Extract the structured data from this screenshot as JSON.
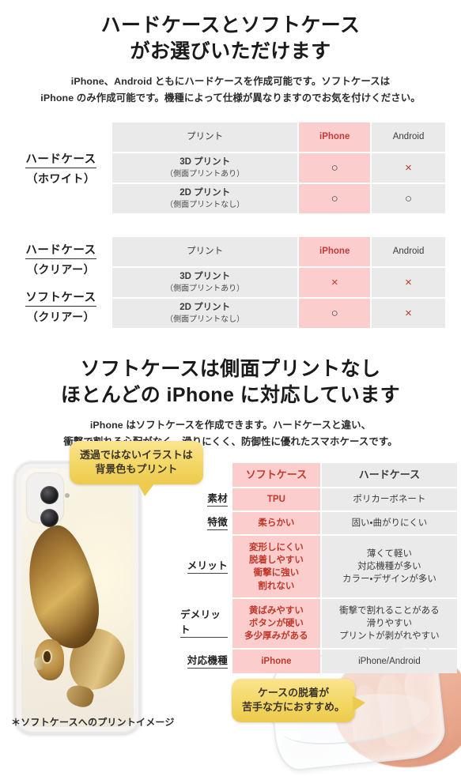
{
  "colors": {
    "pink_cell": "#fbcdcd",
    "gray_cell": "#eaeaea",
    "pink_text": "#c0392b",
    "bubble_yellow": "#f3d765",
    "body_text": "#231f20"
  },
  "section1": {
    "heading_line1": "ハードケースとソフトケース",
    "heading_line2": "がお選びいただけます",
    "sub_line1": "iPhone、Android ともにハードケースを作成可能です。ソフトケースは",
    "sub_line2": "iPhone のみ作成可能です。機種によって仕様が異なりますのでお気を付けください。",
    "table1": {
      "row_labels": [
        {
          "main": "ハードケース",
          "sub": "（ホワイト）"
        }
      ],
      "headers": [
        "プリント",
        "iPhone",
        "Android"
      ],
      "rows": [
        {
          "label_main": "3D プリント",
          "label_note": "（側面プリントあり）",
          "iphone": "○",
          "android": "×"
        },
        {
          "label_main": "2D プリント",
          "label_note": "（側面プリントなし）",
          "iphone": "○",
          "android": "○"
        }
      ]
    },
    "table2": {
      "row_labels": [
        {
          "main": "ハードケース",
          "sub": "（クリアー）"
        },
        {
          "main": "ソフトケース",
          "sub": "（クリアー）"
        }
      ],
      "headers": [
        "プリント",
        "iPhone",
        "Android"
      ],
      "rows": [
        {
          "label_main": "3D プリント",
          "label_note": "（側面プリントあり）",
          "iphone": "×",
          "android": "×"
        },
        {
          "label_main": "2D プリント",
          "label_note": "（側面プリントなし）",
          "iphone": "○",
          "android": "×"
        }
      ]
    }
  },
  "section2": {
    "heading_line1": "ソフトケースは側面プリントなし",
    "heading_line2": "ほとんどの iPhone に対応しています",
    "sub_line1": "iPhone はソフトケースを作成できます。ハードケースと違い、",
    "sub_line2": "衝撃で割れる心配がなく、滑りにくく、防御性に優れたスマホケースです。",
    "spec_table": {
      "headers": [
        "ソフトケース",
        "ハードケース"
      ],
      "row_labels": [
        "素材",
        "特徴",
        "メリット",
        "デメリット",
        "対応機種"
      ],
      "rows": [
        {
          "label": "素材",
          "soft": "TPU",
          "hard": "ポリカーボネート"
        },
        {
          "label": "特徴",
          "soft": "柔らかい",
          "hard": "固い・曲がりにくい"
        },
        {
          "label": "メリット",
          "soft": "変形しにくい\n脱着しやすい\n衝撃に強い\n割れない",
          "hard": "薄くて軽い\n対応機種が多い\nカラー・デザインが多い"
        },
        {
          "label": "デメリット",
          "soft": "黄ばみやすい\nボタンが硬い\n多少厚みがある",
          "hard": "衝撃で割れることがある\n滑りやすい\nプリントが剥がれやすい"
        },
        {
          "label": "対応機種",
          "soft": "iPhone",
          "hard": "iPhone/Android"
        }
      ]
    },
    "bubble1_line1": "透過ではないイラストは",
    "bubble1_line2": "背景色もプリント",
    "bubble2_line1": "ケースの脱着が",
    "bubble2_line2": "苦手な方におすすめ。",
    "footnote": "＊ソフトケースへのプリントイメージ",
    "phone_image_alt": "owl-illustration-phone-case",
    "clearcase_image_alt": "clear-soft-case-in-hand"
  }
}
